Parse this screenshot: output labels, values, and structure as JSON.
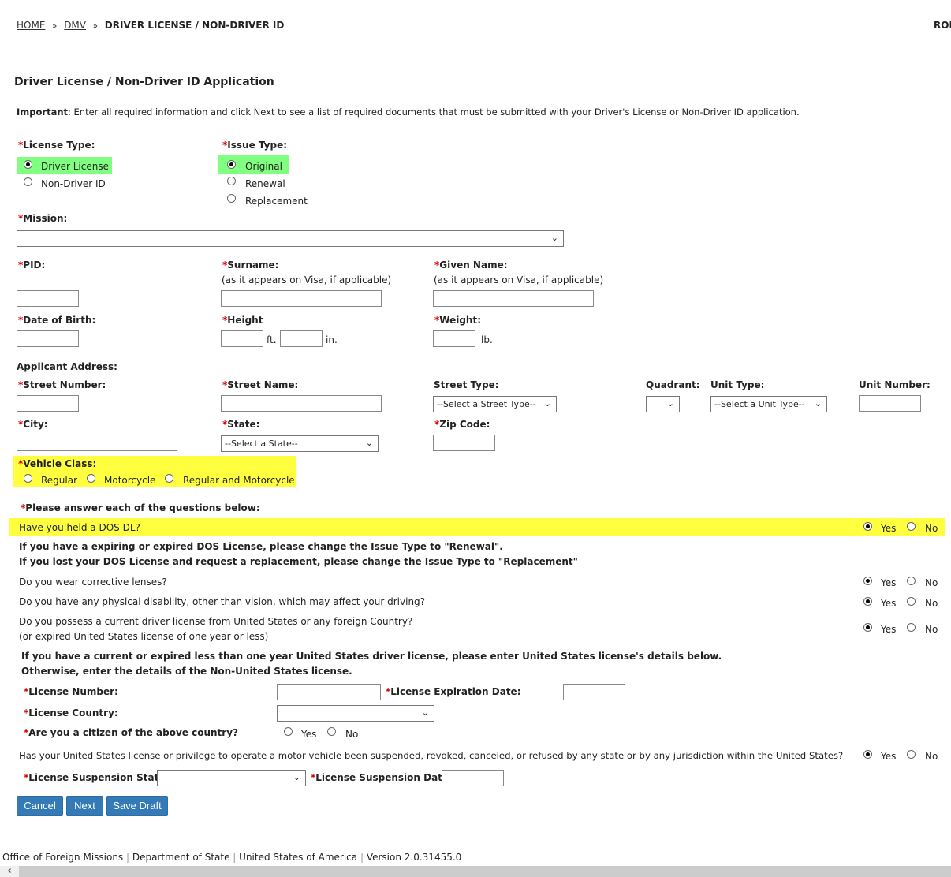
{
  "breadcrumb": {
    "home": "HOME",
    "dmv": "DMV",
    "current": "DRIVER LICENSE / NON-DRIVER ID",
    "sep": "»",
    "right_cut": "ROE"
  },
  "title": "Driver License / Non-Driver ID Application",
  "important": {
    "label": "Important",
    "text": ": Enter all required information and click Next to see a list of required documents that must be submitted with your Driver's License or Non-Driver ID application."
  },
  "license_type": {
    "label": "License Type:",
    "options": [
      "Driver License",
      "Non-Driver ID"
    ],
    "selected": "Driver License"
  },
  "issue_type": {
    "label": "Issue Type:",
    "options": [
      "Original",
      "Renewal",
      "Replacement"
    ],
    "selected": "Original"
  },
  "mission": {
    "label": "Mission:",
    "value": ""
  },
  "pid": {
    "label": "PID:"
  },
  "surname": {
    "label": "Surname:",
    "note": "(as it appears on Visa, if applicable)"
  },
  "given_name": {
    "label": "Given Name:",
    "note": "(as it appears on Visa, if applicable)"
  },
  "dob": {
    "label": "Date of Birth:"
  },
  "height": {
    "label": "Height",
    "ft": "ft.",
    "in": "in."
  },
  "weight": {
    "label": "Weight:",
    "unit": "lb."
  },
  "address": {
    "heading": "Applicant Address:",
    "street_number": "Street Number:",
    "street_name": "Street Name:",
    "street_type": "Street Type:",
    "street_type_value": "--Select a Street Type--",
    "quadrant": "Quadrant:",
    "unit_type": "Unit Type:",
    "unit_type_value": "--Select a Unit Type--",
    "unit_number": "Unit Number:",
    "city": "City:",
    "state": "State:",
    "state_value": "--Select a State--",
    "zip": "Zip Code:"
  },
  "vehicle_class": {
    "label": "Vehicle Class:",
    "options": [
      "Regular",
      "Motorcycle",
      "Regular and Motorcycle"
    ]
  },
  "questions": {
    "intro": "Please answer each of the questions below:",
    "yes": "Yes",
    "no": "No",
    "q1": "Have you held a DOS DL?",
    "note1": "If you have a expiring or expired DOS License, please change the Issue Type to \"Renewal\".",
    "note2": "If you lost your DOS License and request a replacement, please change the Issue Type to \"Replacement\"",
    "q2": "Do you wear corrective lenses?",
    "q3": "Do you have any physical disability, other than vision, which may affect your driving?",
    "q4": "Do you possess a current driver license from United States or any foreign Country?",
    "q4b": "(or expired United States license of one year or less)",
    "note3": "If you have a current or expired less than one year United States driver license, please enter United States license's details below.",
    "note4": "Otherwise, enter the details of the Non-United States license.",
    "q5": "Has your United States license or privilege to operate a motor vehicle been suspended, revoked, canceled, or refused by any state or by any jurisdiction within the United States?",
    "answers": {
      "q1": "Yes",
      "q2": "Yes",
      "q3": "Yes",
      "q4": "Yes",
      "q5": "Yes"
    }
  },
  "license": {
    "number": "License Number:",
    "expiration": "License Expiration Date:",
    "country": "License Country:",
    "citizen": "Are you a citizen of the above country?",
    "susp_state": "License Suspension State:",
    "susp_date": "License Suspension Date:"
  },
  "buttons": {
    "cancel": "Cancel",
    "next": "Next",
    "save": "Save Draft"
  },
  "footer": {
    "a": "Office of Foreign Missions",
    "b": "Department of State",
    "c": "United States of America",
    "d": "Version 2.0.31455.0",
    "sep": "|"
  },
  "colors": {
    "highlight_green": "#80ff80",
    "highlight_yellow": "#ffff40",
    "button": "#337ab7",
    "required": "#dd0000"
  }
}
